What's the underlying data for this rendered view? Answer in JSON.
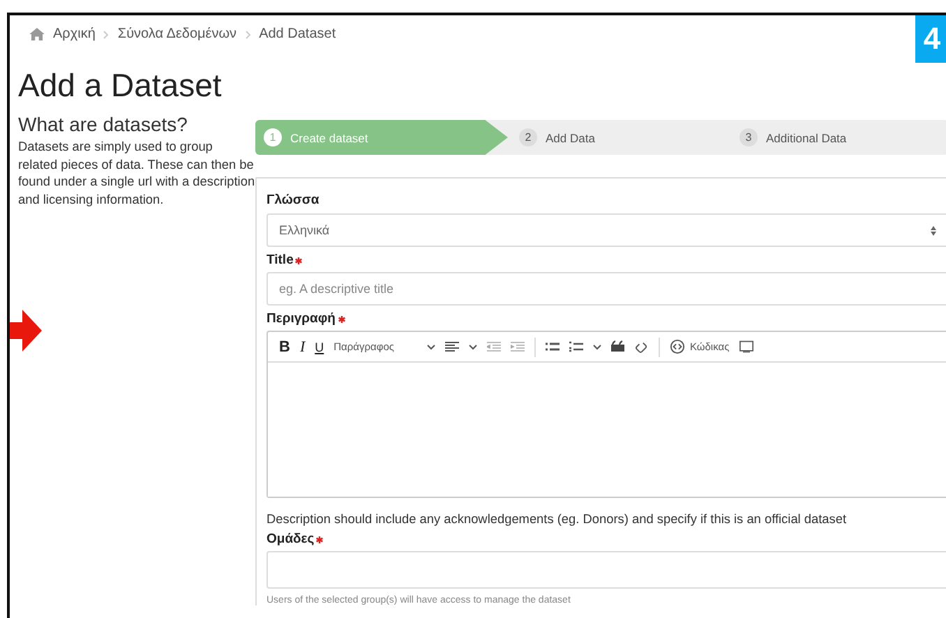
{
  "breadcrumb": [
    "Αρχική",
    "Σύνολα Δεδομένων",
    "Add Dataset"
  ],
  "page_title": "Add a Dataset",
  "sidebar": {
    "heading": "What are datasets?",
    "text": "Datasets are simply used to group related pieces of data. These can then be found under a single url with a description and licensing information."
  },
  "steps": [
    {
      "number": "1",
      "label": "Create dataset",
      "selected": true
    },
    {
      "number": "2",
      "label": "Add Data",
      "selected": false
    },
    {
      "number": "3",
      "label": "Additional Data",
      "selected": false
    }
  ],
  "form": {
    "language": {
      "label": "Γλώσσα",
      "value": "Ελληνικά"
    },
    "title": {
      "label": "Title",
      "required": true,
      "placeholder": "eg. A descriptive title"
    },
    "description": {
      "label": "Περιγραφή",
      "required": true,
      "format_buttons": [
        "B",
        "I",
        "U"
      ],
      "paragraph_dropdown": "Παράγραφος",
      "code_button": "Κώδικας",
      "help": "Description should include any acknowledgements (eg. Donors) and specify if this is an official dataset"
    },
    "groups": {
      "label": "Ομάδες",
      "required": true,
      "help": "Users of the selected group(s) will have access to manage the dataset"
    }
  },
  "step_badge": "4"
}
